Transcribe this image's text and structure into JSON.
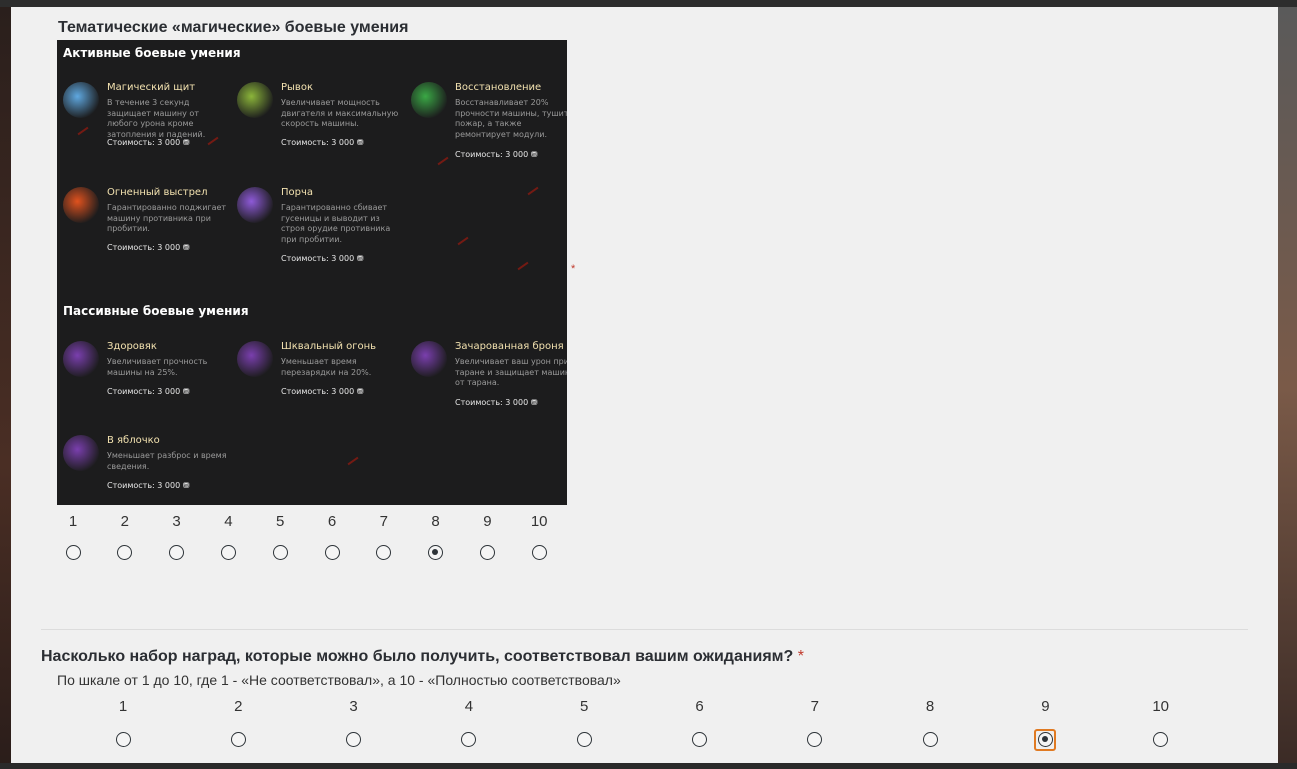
{
  "question1": {
    "title": "Тематические «магические» боевые умения",
    "required_mark": "*",
    "infographic": {
      "active_heading": "Активные боевые умения",
      "passive_heading": "Пассивные боевые умения",
      "skills": [
        {
          "name": "Магический щит",
          "desc": "В течение 3 секунд защищает машину от любого урона кроме затопления и падений.",
          "cost": "Стоимость: 3 000 ⛃",
          "icon": "pumpkin-shield-icon",
          "color": "#5fa8e0"
        },
        {
          "name": "Рывок",
          "desc": "Увеличивает мощность двигателя и максимальную скорость машины.",
          "cost": "Стоимость: 3 000 ⛃",
          "icon": "dash-icon",
          "color": "#8bb53a"
        },
        {
          "name": "Восстановление",
          "desc": "Восстанавливает 20% прочности машины, тушит пожар, а также ремонтирует модули.",
          "cost": "Стоимость: 3 000 ⛃",
          "icon": "potion-icon",
          "color": "#3aa845"
        },
        {
          "name": "Огненный выстрел",
          "desc": "Гарантированно поджигает машину противника при пробитии.",
          "cost": "Стоимость: 3 000 ⛃",
          "icon": "fireball-icon",
          "color": "#e0521e"
        },
        {
          "name": "Порча",
          "desc": "Гарантированно сбивает гусеницы и выводит из строя орудие противника при пробитии.",
          "cost": "Стоимость: 3 000 ⛃",
          "icon": "curse-icon",
          "color": "#8e5ad8"
        },
        {
          "name": "Здоровяк",
          "desc": "Увеличивает прочность машины на 25%.",
          "cost": "Стоимость: 3 000 ⛃",
          "icon": "health-icon",
          "color": "#7a3fae"
        },
        {
          "name": "Шквальный огонь",
          "desc": "Уменьшает время перезарядки на 20%.",
          "cost": "Стоимость: 3 000 ⛃",
          "icon": "reload-icon",
          "color": "#7a3fae"
        },
        {
          "name": "Зачарованная броня",
          "desc": "Увеличивает ваш урон при таране и защищает машину от тарана.",
          "cost": "Стоимость: 3 000 ⛃",
          "icon": "armor-icon",
          "color": "#7a3fae"
        },
        {
          "name": "В яблочко",
          "desc": "Уменьшает разброс и время сведения.",
          "cost": "Стоимость: 3 000 ⛃",
          "icon": "target-icon",
          "color": "#7a3fae"
        }
      ]
    },
    "scale": [
      "1",
      "2",
      "3",
      "4",
      "5",
      "6",
      "7",
      "8",
      "9",
      "10"
    ],
    "selected": 8
  },
  "question2": {
    "title": "Насколько набор наград, которые можно было получить, соответствовал вашим ожиданиям?",
    "required_mark": "*",
    "subtitle": "По шкале от 1 до 10, где 1 - «Не соответствовал», а 10 - «Полностью соответствовал»",
    "scale": [
      "1",
      "2",
      "3",
      "4",
      "5",
      "6",
      "7",
      "8",
      "9",
      "10"
    ],
    "selected": 9
  }
}
